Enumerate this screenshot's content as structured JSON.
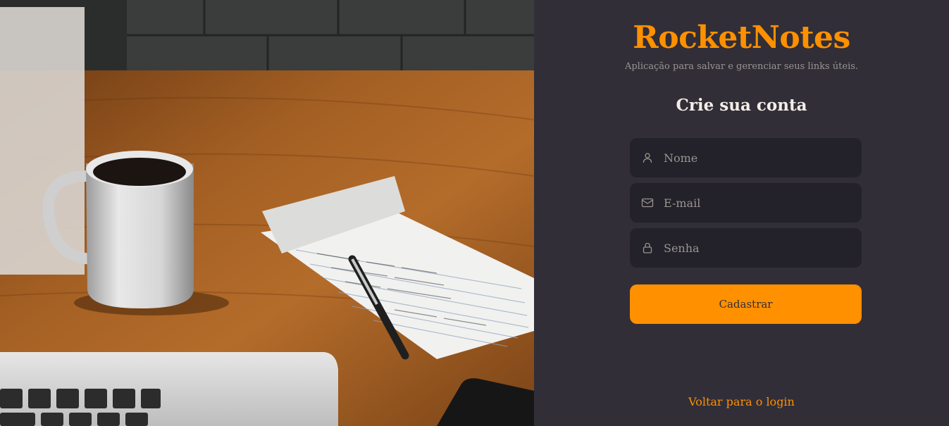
{
  "hero_image": {
    "alt": "coffee-mug-notepad-laptop-photo"
  },
  "brand": {
    "name": "RocketNotes",
    "tagline": "Aplicação para salvar e gerenciar seus links úteis."
  },
  "form": {
    "heading": "Crie sua conta",
    "fields": [
      {
        "icon": "user-icon",
        "placeholder": "Nome",
        "value": ""
      },
      {
        "icon": "mail-icon",
        "placeholder": "E-mail",
        "value": ""
      },
      {
        "icon": "lock-icon",
        "placeholder": "Senha",
        "value": ""
      }
    ],
    "submit_label": "Cadastrar"
  },
  "footer": {
    "back_link": "Voltar para o login"
  },
  "colors": {
    "background": "#312E38",
    "input_bg": "#232129",
    "accent": "#FF9000",
    "text": "#F4EDE8",
    "muted": "#999591"
  }
}
